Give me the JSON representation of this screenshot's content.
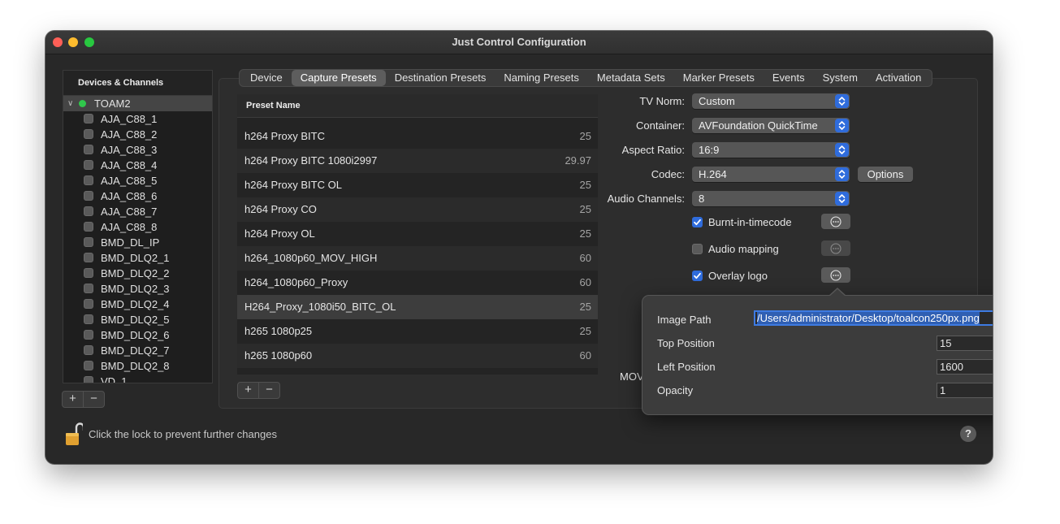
{
  "window": {
    "title": "Just Control Configuration"
  },
  "sidebar": {
    "header": "Devices & Channels",
    "root": {
      "label": "TOAM2",
      "status_color": "#30c74c"
    },
    "channels": [
      "AJA_C88_1",
      "AJA_C88_2",
      "AJA_C88_3",
      "AJA_C88_4",
      "AJA_C88_5",
      "AJA_C88_6",
      "AJA_C88_7",
      "AJA_C88_8",
      "BMD_DL_IP",
      "BMD_DLQ2_1",
      "BMD_DLQ2_2",
      "BMD_DLQ2_3",
      "BMD_DLQ2_4",
      "BMD_DLQ2_5",
      "BMD_DLQ2_6",
      "BMD_DLQ2_7",
      "BMD_DLQ2_8",
      "VD_1"
    ],
    "add_label": "+",
    "remove_label": "−"
  },
  "tabs": [
    {
      "label": "Device",
      "active": false
    },
    {
      "label": "Capture Presets",
      "active": true
    },
    {
      "label": "Destination Presets",
      "active": false
    },
    {
      "label": "Naming Presets",
      "active": false
    },
    {
      "label": "Metadata Sets",
      "active": false
    },
    {
      "label": "Marker Presets",
      "active": false
    },
    {
      "label": "Events",
      "active": false
    },
    {
      "label": "System",
      "active": false
    },
    {
      "label": "Activation",
      "active": false
    }
  ],
  "presets": {
    "header": "Preset Name",
    "rows": [
      {
        "name": "h264 Proxy BITC",
        "rate": "25"
      },
      {
        "name": "h264 Proxy BITC 1080i2997",
        "rate": "29.97"
      },
      {
        "name": "h264 Proxy BITC OL",
        "rate": "25"
      },
      {
        "name": "h264 Proxy CO",
        "rate": "25"
      },
      {
        "name": "h264 Proxy OL",
        "rate": "25"
      },
      {
        "name": "h264_1080p60_MOV_HIGH",
        "rate": "60"
      },
      {
        "name": "h264_1080p60_Proxy",
        "rate": "60"
      },
      {
        "name": "H264_Proxy_1080i50_BITC_OL",
        "rate": "25",
        "selected": true
      },
      {
        "name": "h265 1080p25",
        "rate": "25"
      },
      {
        "name": "h265 1080p60",
        "rate": "60"
      }
    ],
    "add_label": "+",
    "remove_label": "−"
  },
  "form": {
    "tv_norm": {
      "label": "TV Norm:",
      "value": "Custom"
    },
    "container": {
      "label": "Container:",
      "value": "AVFoundation QuickTime"
    },
    "aspect_ratio": {
      "label": "Aspect Ratio:",
      "value": "16:9"
    },
    "codec": {
      "label": "Codec:",
      "value": "H.264"
    },
    "options_label": "Options",
    "audio_channels": {
      "label": "Audio Channels:",
      "value": "8"
    },
    "burnt_in_timecode": {
      "label": "Burnt-in-timecode",
      "checked": true
    },
    "audio_mapping": {
      "label": "Audio mapping",
      "checked": false
    },
    "overlay_logo": {
      "label": "Overlay logo",
      "checked": true
    },
    "clipped_label": "MOV"
  },
  "popover": {
    "image_path": {
      "label": "Image Path",
      "value": "/Users/administrator/Desktop/toalcon250px.png"
    },
    "top_position": {
      "label": "Top Position",
      "value": "15"
    },
    "left_position": {
      "label": "Left Position",
      "value": "1600"
    },
    "opacity": {
      "label": "Opacity",
      "value": "1"
    }
  },
  "footer": {
    "lock_text": "Click the lock to prevent further changes",
    "help_label": "?"
  },
  "colors": {
    "accent": "#2f6cdc",
    "status_online": "#30c74c",
    "lock": "#e0a030"
  }
}
